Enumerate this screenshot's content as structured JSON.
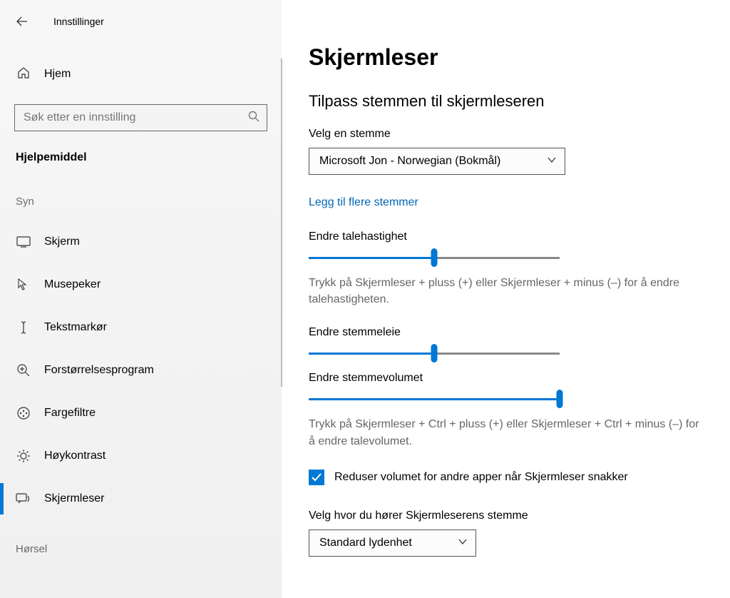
{
  "window": {
    "title": "Innstillinger"
  },
  "sidebar": {
    "home": "Hjem",
    "search_placeholder": "Søk etter en innstilling",
    "category": "Hjelpemiddel",
    "group_vision": "Syn",
    "group_hearing": "Hørsel",
    "items": [
      {
        "label": "Skjerm",
        "icon": "display"
      },
      {
        "label": "Musepeker",
        "icon": "cursor"
      },
      {
        "label": "Tekstmarkør",
        "icon": "textcursor"
      },
      {
        "label": "Forstørrelsesprogram",
        "icon": "magnifier"
      },
      {
        "label": "Fargefiltre",
        "icon": "colorfilter"
      },
      {
        "label": "Høykontrast",
        "icon": "contrast"
      },
      {
        "label": "Skjermleser",
        "icon": "narrator"
      }
    ]
  },
  "main": {
    "heading": "Skjermleser",
    "subheading": "Tilpass stemmen til skjermleseren",
    "voice_label": "Velg en stemme",
    "voice_value": "Microsoft Jon - Norwegian (Bokmål)",
    "add_voices_link": "Legg til flere stemmer",
    "speed": {
      "label": "Endre talehastighet",
      "value": 50,
      "hint": "Trykk på Skjermleser + pluss (+) eller Skjermleser + minus (–) for å endre talehastigheten."
    },
    "pitch": {
      "label": "Endre stemmeleie",
      "value": 50
    },
    "volume": {
      "label": "Endre stemmevolumet",
      "value": 100,
      "hint": "Trykk på Skjermleser + Ctrl + pluss (+) eller Skjermleser + Ctrl + minus (–) for å endre talevolumet."
    },
    "lower_volume_checkbox": "Reduser volumet for andre apper når Skjermleser snakker",
    "lower_volume_checked": true,
    "device_label": "Velg hvor du hører Skjermleserens stemme",
    "device_value": "Standard lydenhet"
  }
}
